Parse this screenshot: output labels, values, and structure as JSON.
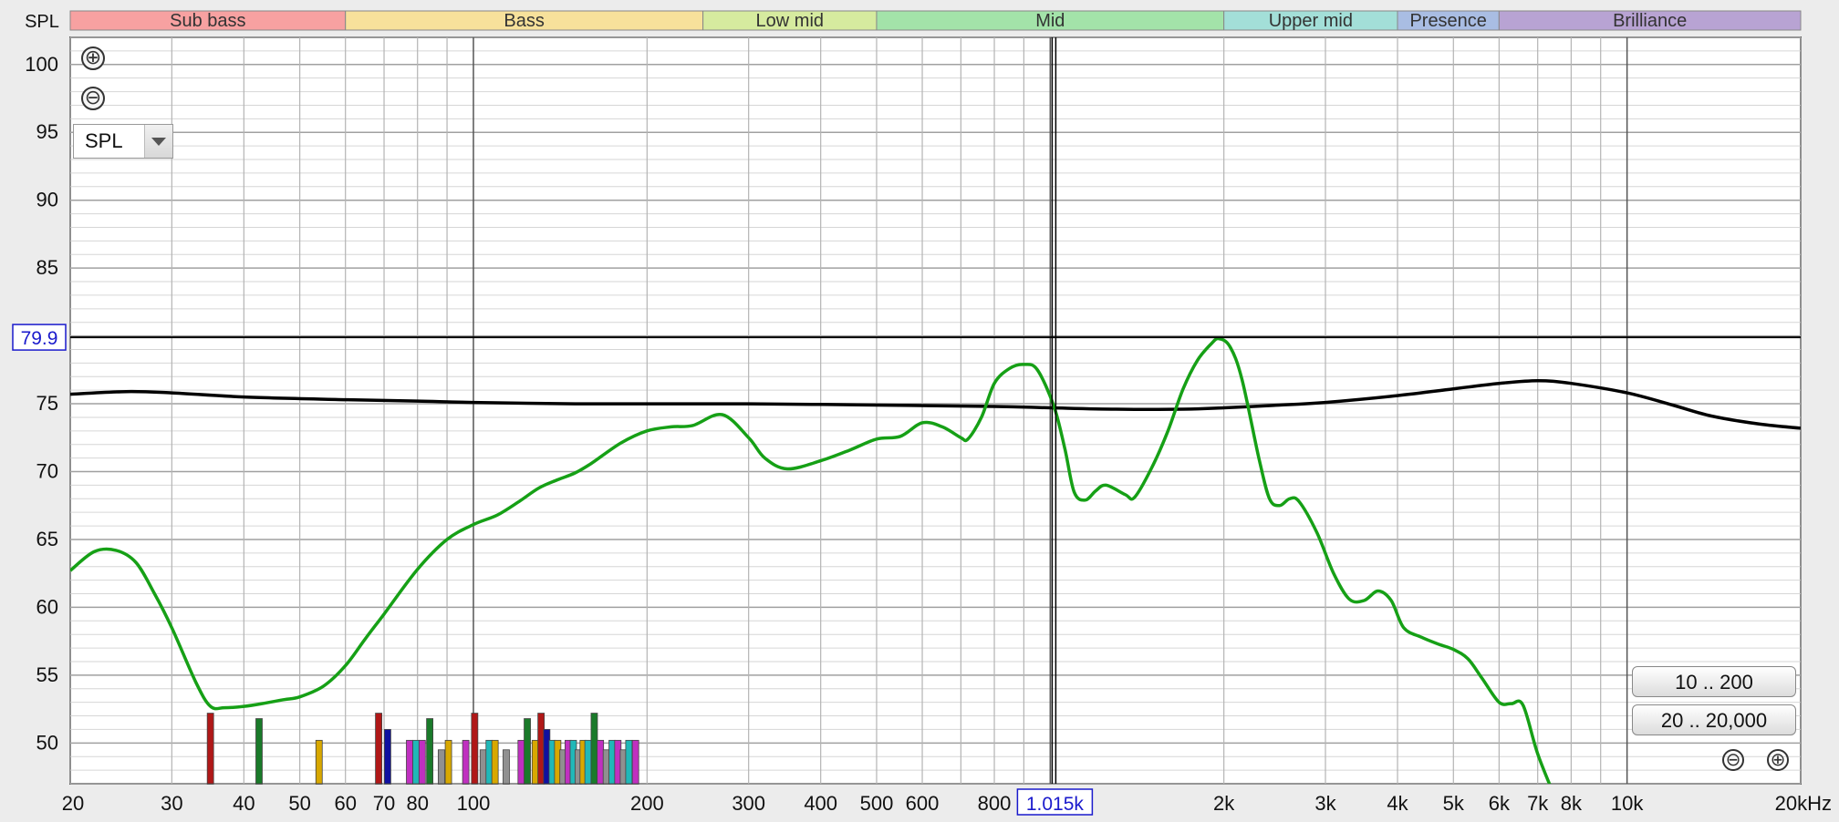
{
  "controls": {
    "zoom_in_symbol": "⊕",
    "zoom_out_symbol": "⊖",
    "dropdown_value": "SPL",
    "range_buttons": [
      "10 .. 200",
      "20 .. 20,000"
    ],
    "small_zoom_out_symbol": "⊖",
    "small_zoom_in_symbol": "⊕"
  },
  "chart_data": {
    "type": "line",
    "ylabel": "SPL",
    "xunit": "kHz",
    "x_scale": "log",
    "xlim": [
      20,
      20000
    ],
    "ylim": [
      47,
      102
    ],
    "grid": true,
    "bands": [
      {
        "name": "Sub bass",
        "from": 20,
        "to": 60,
        "color": "#f7a1a1"
      },
      {
        "name": "Bass",
        "from": 60,
        "to": 250,
        "color": "#f7e19b"
      },
      {
        "name": "Low mid",
        "from": 250,
        "to": 500,
        "color": "#d6eb9f"
      },
      {
        "name": "Mid",
        "from": 500,
        "to": 2000,
        "color": "#a3e3a9"
      },
      {
        "name": "Upper mid",
        "from": 2000,
        "to": 4000,
        "color": "#a3dfd8"
      },
      {
        "name": "Presence",
        "from": 4000,
        "to": 6000,
        "color": "#a9bde3"
      },
      {
        "name": "Brilliance",
        "from": 6000,
        "to": 20000,
        "color": "#b8a3d3"
      }
    ],
    "x_ticks": [
      {
        "value": 20,
        "label": "20"
      },
      {
        "value": 30,
        "label": "30"
      },
      {
        "value": 40,
        "label": "40"
      },
      {
        "value": 50,
        "label": "50"
      },
      {
        "value": 60,
        "label": "60"
      },
      {
        "value": 70,
        "label": "70"
      },
      {
        "value": 80,
        "label": "80"
      },
      {
        "value": 100,
        "label": "100"
      },
      {
        "value": 200,
        "label": "200"
      },
      {
        "value": 300,
        "label": "300"
      },
      {
        "value": 400,
        "label": "400"
      },
      {
        "value": 500,
        "label": "500"
      },
      {
        "value": 600,
        "label": "600"
      },
      {
        "value": 800,
        "label": "800"
      },
      {
        "value": 2000,
        "label": "2k"
      },
      {
        "value": 3000,
        "label": "3k"
      },
      {
        "value": 4000,
        "label": "4k"
      },
      {
        "value": 5000,
        "label": "5k"
      },
      {
        "value": 6000,
        "label": "6k"
      },
      {
        "value": 7000,
        "label": "7k"
      },
      {
        "value": 8000,
        "label": "8k"
      },
      {
        "value": 10000,
        "label": "10k"
      },
      {
        "value": 20000,
        "label": "20kHz"
      }
    ],
    "y_ticks": [
      {
        "value": 50,
        "label": "50"
      },
      {
        "value": 55,
        "label": "55"
      },
      {
        "value": 60,
        "label": "60"
      },
      {
        "value": 65,
        "label": "65"
      },
      {
        "value": 70,
        "label": "70"
      },
      {
        "value": 75,
        "label": "75"
      },
      {
        "value": 80,
        "label": "80"
      },
      {
        "value": 85,
        "label": "85"
      },
      {
        "value": 90,
        "label": "90"
      },
      {
        "value": 95,
        "label": "95"
      },
      {
        "value": 100,
        "label": "100"
      }
    ],
    "cursor": {
      "x": 1015,
      "y": 79.9,
      "x_label": "1.015k",
      "y_label": "79.9"
    },
    "series": [
      {
        "color": "#000000",
        "points": [
          [
            20,
            75.7
          ],
          [
            25,
            75.9
          ],
          [
            30,
            75.8
          ],
          [
            40,
            75.5
          ],
          [
            60,
            75.3
          ],
          [
            80,
            75.2
          ],
          [
            100,
            75.1
          ],
          [
            150,
            75.0
          ],
          [
            200,
            75.0
          ],
          [
            300,
            75.0
          ],
          [
            500,
            74.9
          ],
          [
            800,
            74.8
          ],
          [
            1000,
            74.7
          ],
          [
            1300,
            74.6
          ],
          [
            1700,
            74.6
          ],
          [
            2000,
            74.7
          ],
          [
            2500,
            74.9
          ],
          [
            3000,
            75.1
          ],
          [
            4000,
            75.6
          ],
          [
            5000,
            76.1
          ],
          [
            6000,
            76.5
          ],
          [
            7000,
            76.7
          ],
          [
            8000,
            76.5
          ],
          [
            10000,
            75.8
          ],
          [
            12000,
            74.9
          ],
          [
            14000,
            74.1
          ],
          [
            17000,
            73.5
          ],
          [
            20000,
            73.2
          ]
        ]
      },
      {
        "color": "#16a016",
        "points": [
          [
            20,
            62.7
          ],
          [
            22,
            64.1
          ],
          [
            24,
            64.2
          ],
          [
            26,
            63.3
          ],
          [
            28,
            61.0
          ],
          [
            30,
            58.5
          ],
          [
            33,
            54.5
          ],
          [
            35,
            52.7
          ],
          [
            37,
            52.6
          ],
          [
            40,
            52.7
          ],
          [
            43,
            52.9
          ],
          [
            47,
            53.2
          ],
          [
            50,
            53.4
          ],
          [
            55,
            54.2
          ],
          [
            60,
            55.7
          ],
          [
            65,
            57.7
          ],
          [
            70,
            59.5
          ],
          [
            80,
            62.8
          ],
          [
            90,
            65.0
          ],
          [
            100,
            66.1
          ],
          [
            110,
            66.8
          ],
          [
            120,
            67.8
          ],
          [
            130,
            68.8
          ],
          [
            140,
            69.4
          ],
          [
            150,
            69.9
          ],
          [
            160,
            70.6
          ],
          [
            180,
            72.1
          ],
          [
            200,
            73.0
          ],
          [
            220,
            73.3
          ],
          [
            240,
            73.4
          ],
          [
            270,
            74.2
          ],
          [
            300,
            72.5
          ],
          [
            320,
            71.0
          ],
          [
            350,
            70.2
          ],
          [
            400,
            70.8
          ],
          [
            450,
            71.6
          ],
          [
            500,
            72.4
          ],
          [
            550,
            72.6
          ],
          [
            600,
            73.6
          ],
          [
            650,
            73.3
          ],
          [
            700,
            72.5
          ],
          [
            720,
            72.4
          ],
          [
            760,
            74.0
          ],
          [
            800,
            76.5
          ],
          [
            850,
            77.6
          ],
          [
            900,
            77.9
          ],
          [
            950,
            77.5
          ],
          [
            1015,
            74.8
          ],
          [
            1060,
            71.7
          ],
          [
            1100,
            68.5
          ],
          [
            1150,
            67.9
          ],
          [
            1200,
            68.6
          ],
          [
            1250,
            69.0
          ],
          [
            1350,
            68.3
          ],
          [
            1400,
            68.1
          ],
          [
            1500,
            70.3
          ],
          [
            1600,
            73.0
          ],
          [
            1700,
            76.1
          ],
          [
            1800,
            78.2
          ],
          [
            1900,
            79.4
          ],
          [
            1960,
            79.8
          ],
          [
            2050,
            79.2
          ],
          [
            2150,
            76.8
          ],
          [
            2300,
            71.0
          ],
          [
            2400,
            68.0
          ],
          [
            2500,
            67.5
          ],
          [
            2600,
            68.0
          ],
          [
            2700,
            67.8
          ],
          [
            2900,
            65.5
          ],
          [
            3100,
            62.5
          ],
          [
            3300,
            60.6
          ],
          [
            3500,
            60.5
          ],
          [
            3700,
            61.2
          ],
          [
            3900,
            60.5
          ],
          [
            4100,
            58.5
          ],
          [
            4400,
            57.8
          ],
          [
            4700,
            57.3
          ],
          [
            5000,
            56.9
          ],
          [
            5300,
            56.2
          ],
          [
            5600,
            54.8
          ],
          [
            6000,
            53.0
          ],
          [
            6300,
            52.9
          ],
          [
            6600,
            52.8
          ],
          [
            7000,
            49.2
          ],
          [
            7500,
            46.0
          ]
        ]
      }
    ],
    "marker_bars": [
      {
        "x": 35,
        "top": 52.2,
        "color": "#b01818"
      },
      {
        "x": 42.5,
        "top": 51.8,
        "color": "#1a7a2a"
      },
      {
        "x": 54,
        "top": 50.2,
        "color": "#d8a800"
      },
      {
        "x": 68.5,
        "top": 52.2,
        "color": "#b01818"
      },
      {
        "x": 71,
        "top": 51.0,
        "color": "#1010a0"
      },
      {
        "x": 77.5,
        "top": 50.2,
        "color": "#c030c0"
      },
      {
        "x": 79.5,
        "top": 50.2,
        "color": "#20b8b8"
      },
      {
        "x": 81.5,
        "top": 50.2,
        "color": "#c030c0"
      },
      {
        "x": 84,
        "top": 51.8,
        "color": "#1a7a2a"
      },
      {
        "x": 88,
        "top": 49.5,
        "color": "#909090"
      },
      {
        "x": 90.5,
        "top": 50.2,
        "color": "#d8a800"
      },
      {
        "x": 97,
        "top": 50.2,
        "color": "#c030c0"
      },
      {
        "x": 100.5,
        "top": 52.2,
        "color": "#b01818"
      },
      {
        "x": 104,
        "top": 49.5,
        "color": "#909090"
      },
      {
        "x": 106.5,
        "top": 50.2,
        "color": "#20b8b8"
      },
      {
        "x": 109,
        "top": 50.2,
        "color": "#d8a800"
      },
      {
        "x": 114,
        "top": 49.5,
        "color": "#909090"
      },
      {
        "x": 121,
        "top": 50.2,
        "color": "#c030c0"
      },
      {
        "x": 124,
        "top": 51.8,
        "color": "#1a7a2a"
      },
      {
        "x": 128,
        "top": 50.2,
        "color": "#d8a800"
      },
      {
        "x": 131,
        "top": 52.2,
        "color": "#b01818"
      },
      {
        "x": 134,
        "top": 51.0,
        "color": "#1010a0"
      },
      {
        "x": 137,
        "top": 50.2,
        "color": "#20b8b8"
      },
      {
        "x": 140,
        "top": 50.2,
        "color": "#d8a800"
      },
      {
        "x": 143,
        "top": 49.5,
        "color": "#909090"
      },
      {
        "x": 146,
        "top": 50.2,
        "color": "#c030c0"
      },
      {
        "x": 149,
        "top": 50.2,
        "color": "#20b8b8"
      },
      {
        "x": 152,
        "top": 49.5,
        "color": "#909090"
      },
      {
        "x": 155,
        "top": 50.2,
        "color": "#d8a800"
      },
      {
        "x": 158,
        "top": 50.2,
        "color": "#20b8b8"
      },
      {
        "x": 162,
        "top": 52.2,
        "color": "#1a7a2a"
      },
      {
        "x": 166,
        "top": 50.2,
        "color": "#c030c0"
      },
      {
        "x": 170,
        "top": 49.5,
        "color": "#909090"
      },
      {
        "x": 174,
        "top": 50.2,
        "color": "#20b8b8"
      },
      {
        "x": 178,
        "top": 50.2,
        "color": "#c030c0"
      },
      {
        "x": 182,
        "top": 49.5,
        "color": "#909090"
      },
      {
        "x": 186,
        "top": 50.2,
        "color": "#20b8b8"
      },
      {
        "x": 191,
        "top": 50.2,
        "color": "#c030c0"
      }
    ]
  }
}
